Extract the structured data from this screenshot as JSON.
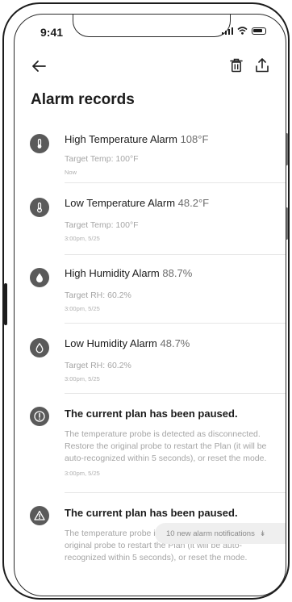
{
  "status_bar": {
    "time": "9:41"
  },
  "nav": {
    "back_icon": "arrow-left-icon",
    "trash_icon": "trash-icon",
    "share_icon": "share-icon"
  },
  "page": {
    "title": "Alarm records"
  },
  "records": [
    {
      "icon": "thermometer-high-icon",
      "title": "High Temperature Alarm",
      "value": "108°F",
      "sub": "Target Temp: 100°F",
      "time": "Now"
    },
    {
      "icon": "thermometer-low-icon",
      "title": "Low Temperature Alarm",
      "value": "48.2°F",
      "sub": "Target Temp: 100°F",
      "time": "3:00pm, 5/25"
    },
    {
      "icon": "droplet-high-icon",
      "title": "High Humidity Alarm",
      "value": "88.7%",
      "sub": "Target RH: 60.2%",
      "time": "3:00pm, 5/25"
    },
    {
      "icon": "droplet-low-icon",
      "title": "Low Humidity Alarm",
      "value": "48.7%",
      "sub": "Target RH: 60.2%",
      "time": "3:00pm, 5/25"
    },
    {
      "icon": "pause-circle-icon",
      "title": "The current plan has been paused.",
      "value": "",
      "sub": "The temperature probe is detected as disconnected. Restore the original probe to restart the Plan (it will be auto-recognized within 5 seconds), or reset the mode.",
      "time": "3:00pm, 5/25"
    },
    {
      "icon": "warning-triangle-icon",
      "title": "The current plan has been paused.",
      "value": "",
      "sub": "The temperature probe is abnormal. Restore the original probe to restart the Plan (it will be auto-recognized within 5 seconds), or reset the mode.",
      "time": ""
    }
  ],
  "toast": {
    "label": "10 new alarm notifications",
    "icon": "double-chevron-down-icon"
  }
}
